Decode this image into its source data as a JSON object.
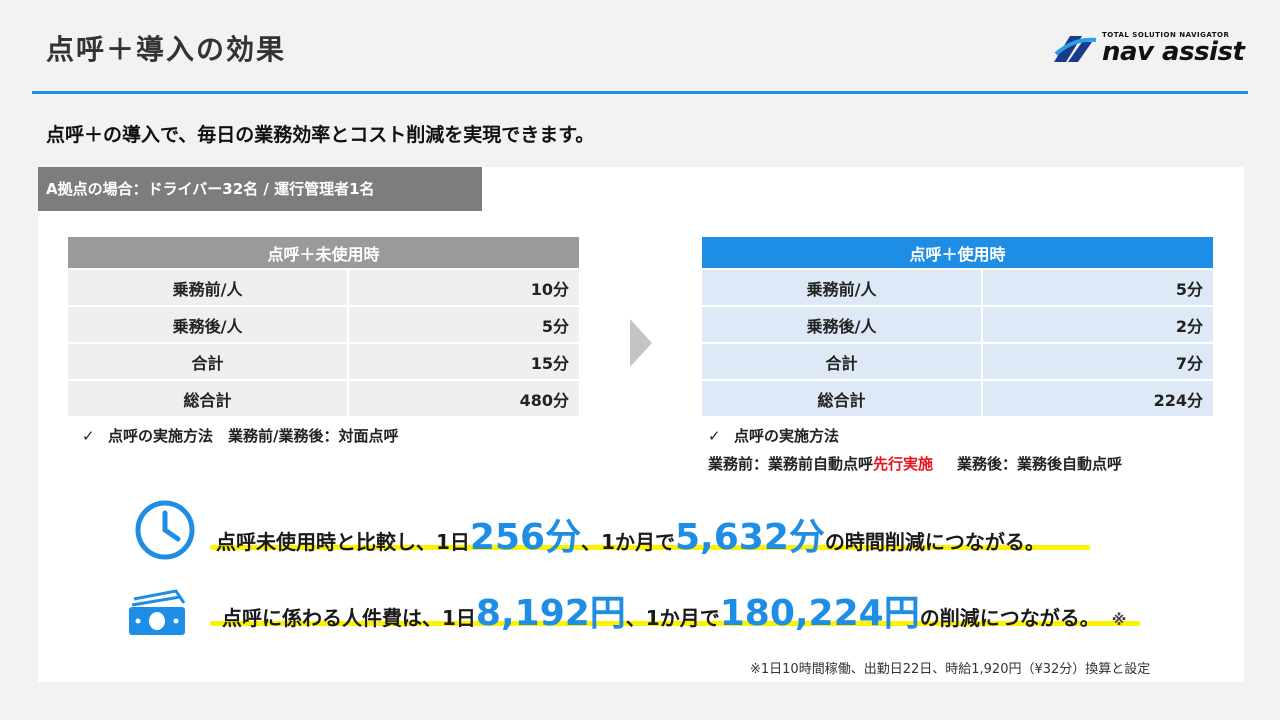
{
  "header": {
    "title": "点呼＋導入の効果",
    "logo_tagline": "TOTAL SOLUTION NAVIGATOR",
    "logo_wordmark": "nav assist",
    "accent_color": "#1e90e8"
  },
  "subtitle": "点呼＋の導入で、毎日の業務効率とコスト削減を実現できます。",
  "scenario_label": "A拠点の場合：ドライバー32名 / 運行管理者1名",
  "before": {
    "heading": "点呼＋未使用時",
    "rows": [
      {
        "label": "乗務前/人",
        "value": "10分"
      },
      {
        "label": "乗務後/人",
        "value": "5分"
      },
      {
        "label": "合計",
        "value": "15分"
      },
      {
        "label": "総合計",
        "value": "480分"
      }
    ],
    "check": "✓",
    "method_note": "点呼の実施方法　業務前/業務後：対面点呼"
  },
  "after": {
    "heading": "点呼＋使用時",
    "rows": [
      {
        "label": "乗務前/人",
        "value": "5分"
      },
      {
        "label": "乗務後/人",
        "value": "2分"
      },
      {
        "label": "合計",
        "value": "7分"
      },
      {
        "label": "総合計",
        "value": "224分"
      }
    ],
    "check": "✓",
    "method_title": "点呼の実施方法",
    "method_pre": "業務前：業務前自動点呼",
    "method_highlight": "先行実施",
    "method_post": "業務後：業務後自動点呼"
  },
  "time_saving": {
    "icon": "clock-icon",
    "p1": "点呼未使用時と比較し、1日",
    "daily": "256分",
    "p2": "、1か月で",
    "monthly": "5,632分",
    "p3": "の時間削減につながる。"
  },
  "cost_saving": {
    "icon": "money-icon",
    "p1": "点呼に係わる人件費は、1日",
    "daily": "8,192円",
    "p2": "、1か月で",
    "monthly": "180,224円",
    "p3": "の削減につながる。",
    "mark": "※"
  },
  "footnote": "※1日10時間稼働、出勤日22日、時給1,920円（¥32分）換算と設定",
  "colors": {
    "highlight_blue": "#1e8de6",
    "highlight_red": "#e8141a",
    "underline_yellow": "#fff200"
  }
}
